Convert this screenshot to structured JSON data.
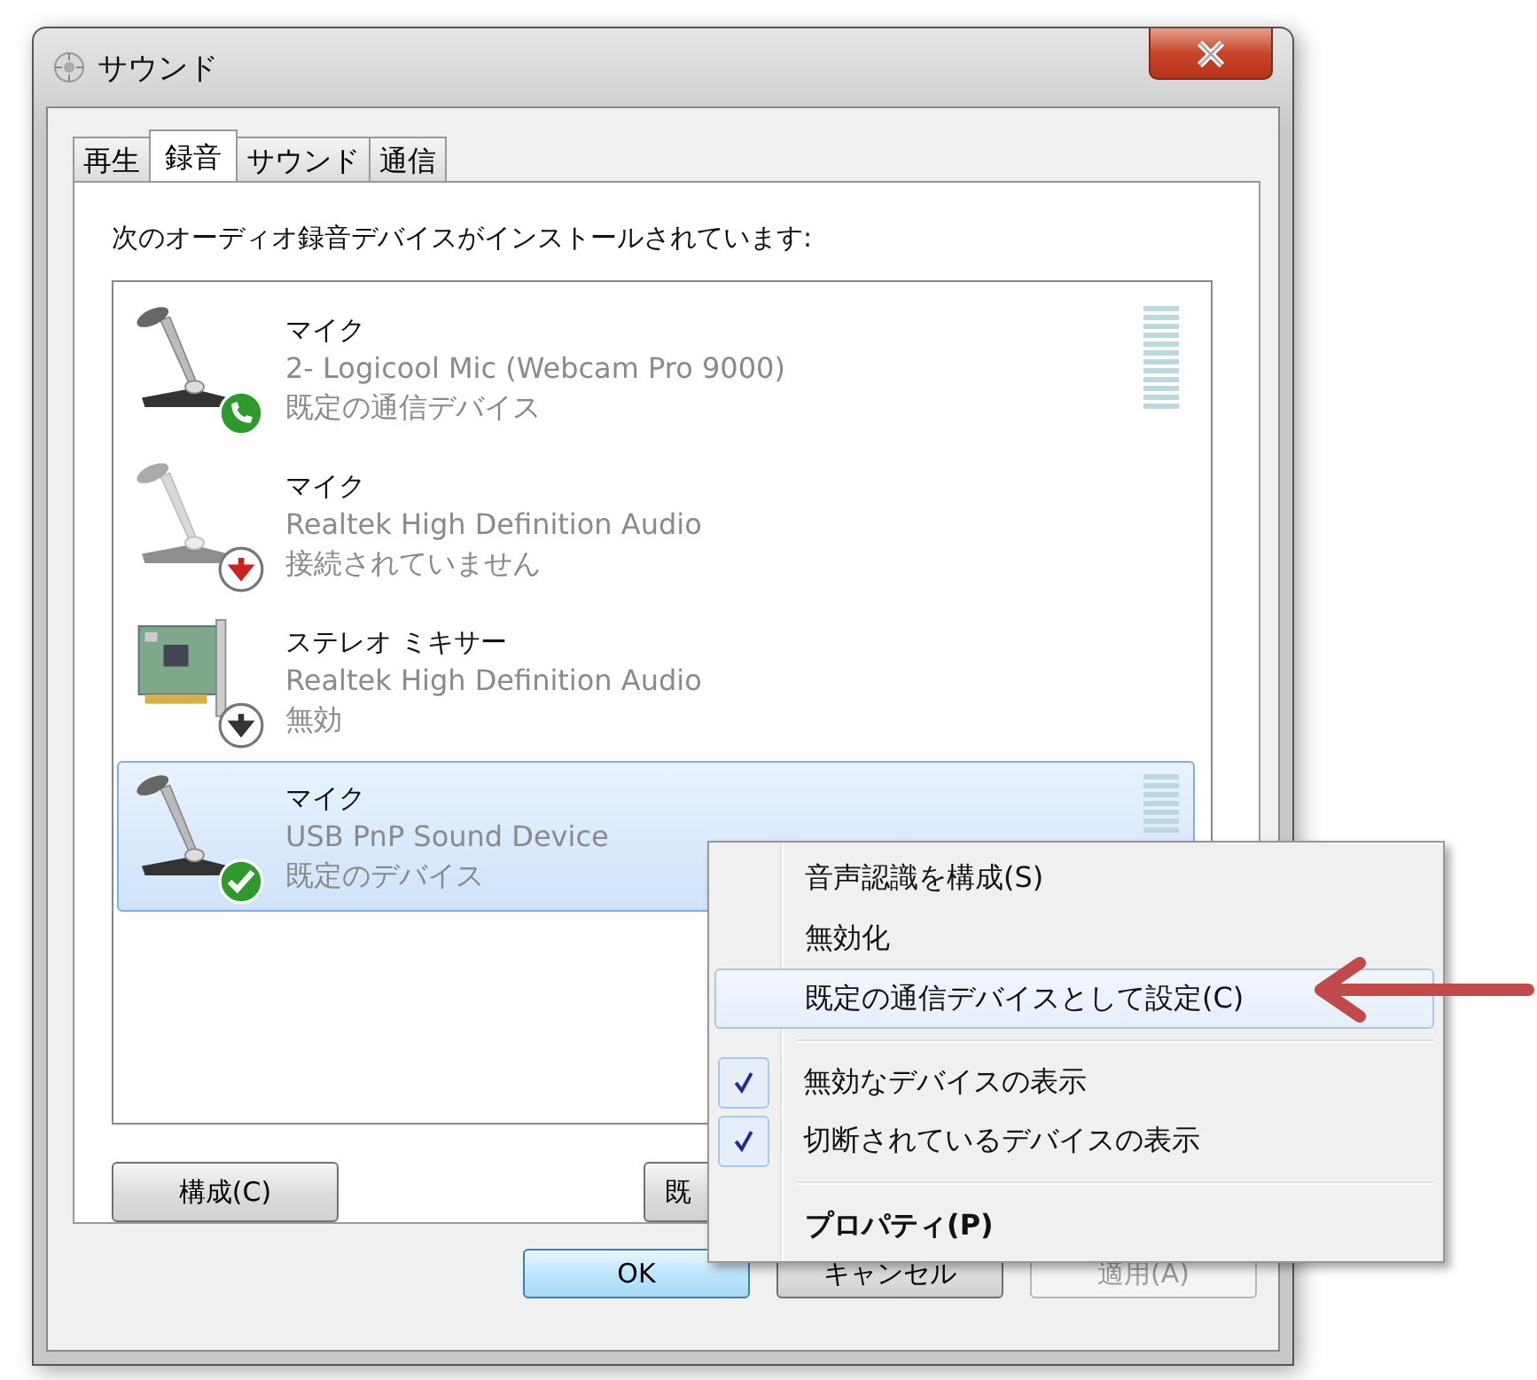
{
  "window": {
    "title": "サウンド"
  },
  "tabs": [
    {
      "label": "再生",
      "selected": false
    },
    {
      "label": "録音",
      "selected": true
    },
    {
      "label": "サウンド",
      "selected": false
    },
    {
      "label": "通信",
      "selected": false
    }
  ],
  "intro": "次のオーディオ録音デバイスがインストールされています:",
  "devices": [
    {
      "name": "マイク",
      "description": "2- Logicool Mic (Webcam Pro 9000)",
      "status": "既定の通信デバイス",
      "kind": "communication",
      "selected": false
    },
    {
      "name": "マイク",
      "description": "Realtek High Definition Audio",
      "status": "接続されていません",
      "kind": "unplugged",
      "selected": false
    },
    {
      "name": "ステレオ ミキサー",
      "description": "Realtek High Definition Audio",
      "status": "無効",
      "kind": "mixer",
      "selected": false
    },
    {
      "name": "マイク",
      "description": "USB PnP Sound Device",
      "status": "既定のデバイス",
      "kind": "default",
      "selected": true
    }
  ],
  "panel_buttons": [
    "構成(C)",
    "既"
  ],
  "context_menu": [
    {
      "kind": "item",
      "label": "音声認識を構成(S)",
      "selected": false
    },
    {
      "kind": "item",
      "label": "無効化",
      "selected": false
    },
    {
      "kind": "item",
      "label": "既定の通信デバイスとして設定(C)",
      "selected": true
    },
    {
      "kind": "separator"
    },
    {
      "kind": "check",
      "label": "無効なデバイスの表示",
      "checked": true
    },
    {
      "kind": "check",
      "label": "切断されているデバイスの表示",
      "checked": true
    },
    {
      "kind": "separator"
    },
    {
      "kind": "item",
      "label": "プロパティ(P)",
      "selected": false,
      "default": true
    }
  ],
  "dialog_buttons": [
    {
      "label": "OK",
      "default": true,
      "disabled": false
    },
    {
      "label": "キャンセル",
      "default": false,
      "disabled": false
    },
    {
      "label": "適用(A)",
      "default": false,
      "disabled": true
    }
  ]
}
